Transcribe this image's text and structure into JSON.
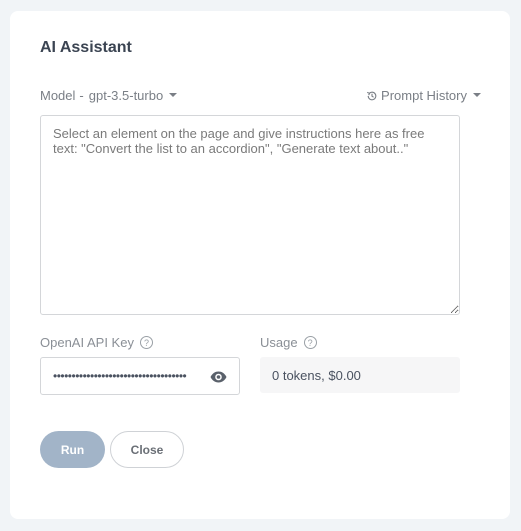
{
  "dialog": {
    "title": "AI Assistant",
    "model": {
      "label": "Model",
      "separator": "-",
      "selected": "gpt-3.5-turbo",
      "icon": "caret-down-icon"
    },
    "prompt_history": {
      "label": "Prompt History",
      "icon": "history-icon",
      "caret_icon": "caret-down-icon"
    },
    "prompt": {
      "value": "",
      "placeholder": "Select an element on the page and give instructions here as free text: \"Convert the list to an accordion\", \"Generate text about..\""
    },
    "api_key": {
      "label": "OpenAI API Key",
      "help_icon": "question-circle-icon",
      "value": "••••••••••••••••••••••••••••••••••••",
      "toggle_icon": "eye-icon"
    },
    "usage": {
      "label": "Usage",
      "help_icon": "question-circle-icon",
      "value": "0 tokens, $0.00"
    },
    "buttons": {
      "run": "Run",
      "close": "Close"
    }
  },
  "colors": {
    "page_background": "#f1f4f7",
    "card_background": "#ffffff",
    "run_button": "#a2b4c8",
    "title_text": "#3b4452"
  }
}
